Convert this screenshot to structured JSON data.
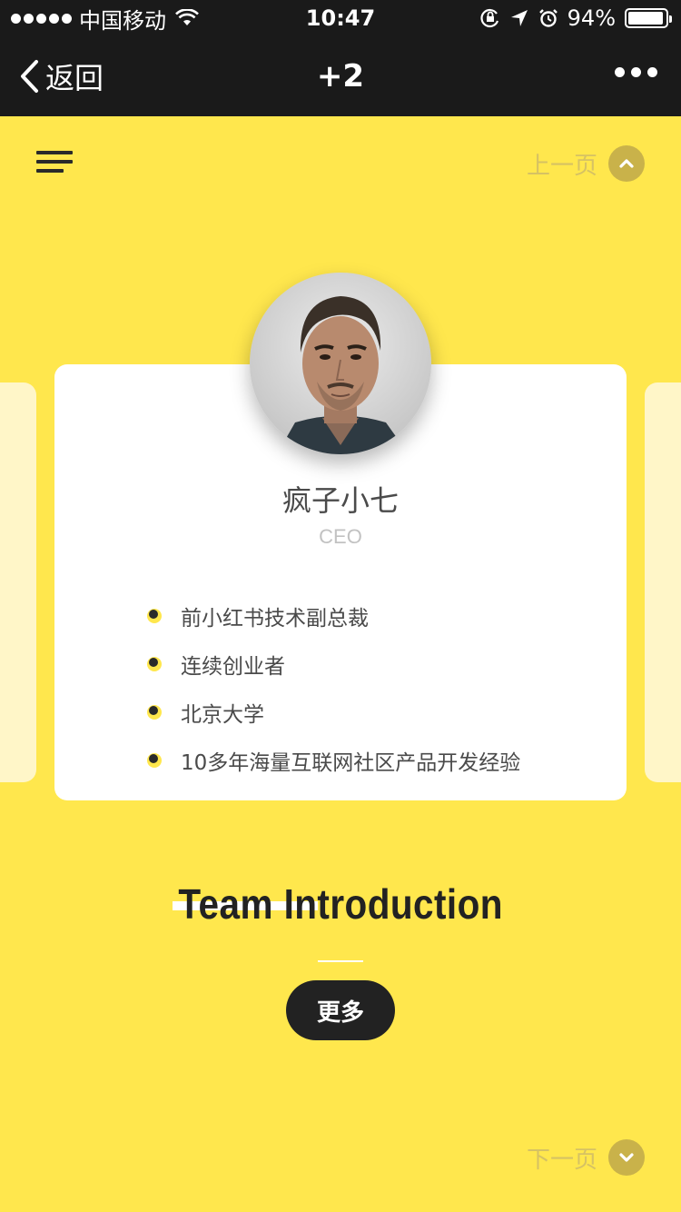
{
  "status_bar": {
    "carrier": "中国移动",
    "time": "10:47",
    "battery_percent": "94%",
    "battery_level": 0.94
  },
  "nav_bar": {
    "back_label": "返回",
    "title": "+2"
  },
  "page_nav": {
    "prev_label": "上一页",
    "next_label": "下一页"
  },
  "profile": {
    "name": "疯子小七",
    "role": "CEO",
    "bio": [
      "前小红书技术副总裁",
      "连续创业者",
      "北京大学",
      "10多年海量互联网社区产品开发经验"
    ]
  },
  "team_section": {
    "title": "Team Introduction",
    "more_label": "更多"
  },
  "colors": {
    "accent_yellow": "#ffe74d",
    "dark": "#1a1a1a",
    "card": "#ffffff"
  }
}
